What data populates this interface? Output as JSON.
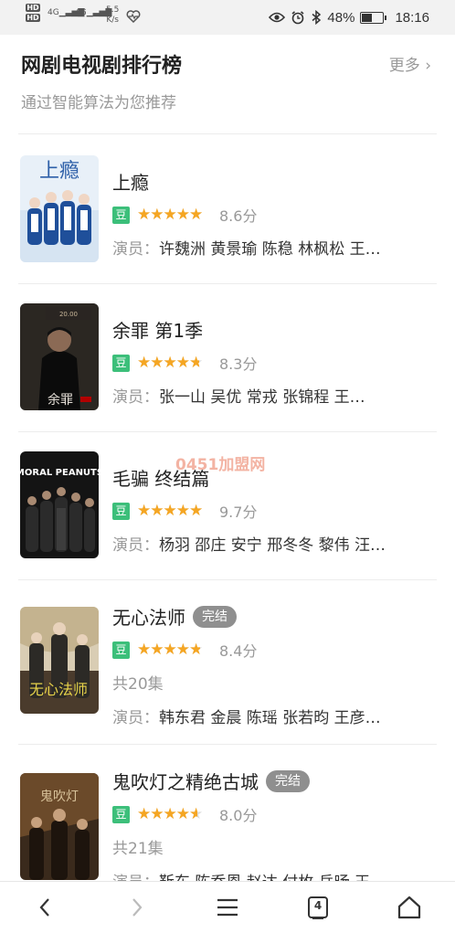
{
  "status_bar": {
    "hd1": "HD",
    "hd2": "HD",
    "sig1": "4G",
    "sig2": "4G",
    "speed_value": "5.5",
    "speed_unit": "K/s",
    "battery_percent": "48%",
    "battery_level": 0.48,
    "time": "18:16",
    "icons": [
      "eye-icon",
      "alarm-icon",
      "bluetooth-icon",
      "battery-icon",
      "health-heart-icon"
    ]
  },
  "section": {
    "title": "网剧电视剧排行榜",
    "more": "更多 ›",
    "subtitle": "通过智能算法为您推荐"
  },
  "items": [
    {
      "name": "上瘾",
      "badge": "",
      "rating": 4.3,
      "score": "8.6分",
      "episodes": "",
      "cast_label": "演员：",
      "cast": "许魏洲 黄景瑜 陈稳 林枫松 王…",
      "poster_text": "上瘾",
      "dou": "豆"
    },
    {
      "name": "余罪 第1季",
      "badge": "",
      "rating": 4.15,
      "score": "8.3分",
      "episodes": "",
      "cast_label": "演员：",
      "cast": "张一山 吴优 常戎 张锦程 王…",
      "poster_text": "余罪",
      "dou": "豆"
    },
    {
      "name": "毛骗 终结篇",
      "badge": "",
      "rating": 4.85,
      "score": "9.7分",
      "episodes": "",
      "cast_label": "演员：",
      "cast": "杨羽 邵庄 安宁 邢冬冬 黎伟 汪…",
      "poster_text": "MORAL PEANUTS",
      "dou": "豆"
    },
    {
      "name": "无心法师",
      "badge": "完结",
      "rating": 4.2,
      "score": "8.4分",
      "episodes": "共20集",
      "cast_label": "演员：",
      "cast": "韩东君 金晨 陈瑶 张若昀 王彦…",
      "poster_text": "无心法师",
      "dou": "豆"
    },
    {
      "name": "鬼吹灯之精绝古城",
      "badge": "完结",
      "rating": 4.0,
      "score": "8.0分",
      "episodes": "共21集",
      "cast_label": "演员：",
      "cast": "靳东 陈乔恩 赵达 付枚 岳旸 王…",
      "poster_text": "鬼吹灯",
      "dou": "豆"
    }
  ],
  "watermark": "0451加盟网",
  "nav": {
    "tab_count": "4",
    "icons": [
      "back-icon",
      "forward-icon",
      "menu-icon",
      "tabs-icon",
      "home-icon"
    ]
  }
}
